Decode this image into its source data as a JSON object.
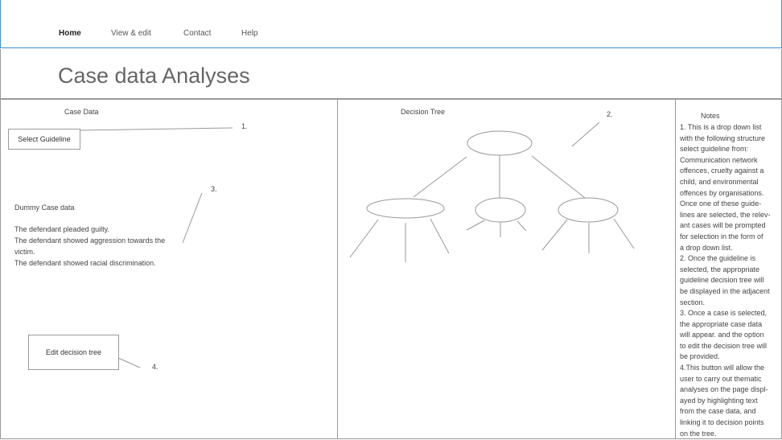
{
  "nav": {
    "items": [
      {
        "label": "Home"
      },
      {
        "label": "View & edit"
      },
      {
        "label": "Contact"
      },
      {
        "label": "Help"
      }
    ]
  },
  "page": {
    "title": "Case data Analyses"
  },
  "case_panel": {
    "heading": "Case Data",
    "select_button": "Select Guideline",
    "case_title": "Dummy Case data",
    "case_lines": [
      "The defendant pleaded guilty.",
      "The defendant showed aggression towards the",
      "victim.",
      "The defendant showed racial discrimination."
    ],
    "edit_button": "Edit decision tree",
    "marker1": "1.",
    "marker3": "3.",
    "marker4": "4."
  },
  "tree_panel": {
    "heading": "Decision Tree",
    "marker2": "2."
  },
  "notes_panel": {
    "heading": "Notes",
    "lines": [
      "1. This is a drop down list",
      "with the following structure",
      "select guideline from:",
      "Communication network",
      "offences, cruelty against a",
      "child, and environmental",
      "offences by organisations.",
      "Once one of these guide-",
      "lines are selected, the relev-",
      "ant cases will be prompted",
      "for selection in the form of",
      "a drop down list.",
      "2. Once the guideline is",
      "selected, the appropriate",
      "guideline decision tree will",
      "be displayed in the adjacent",
      "section.",
      "3. Once a case is selected,",
      "the appropriate case data",
      "will appear. and the option",
      "to edit the decision tree will",
      "be provided.",
      "4.This button will allow the",
      "user to carry out thematic",
      "analyses on the page displ-",
      "ayed by highlighting text",
      "from the case data, and",
      "linking it to decision points",
      "on the tree."
    ]
  }
}
